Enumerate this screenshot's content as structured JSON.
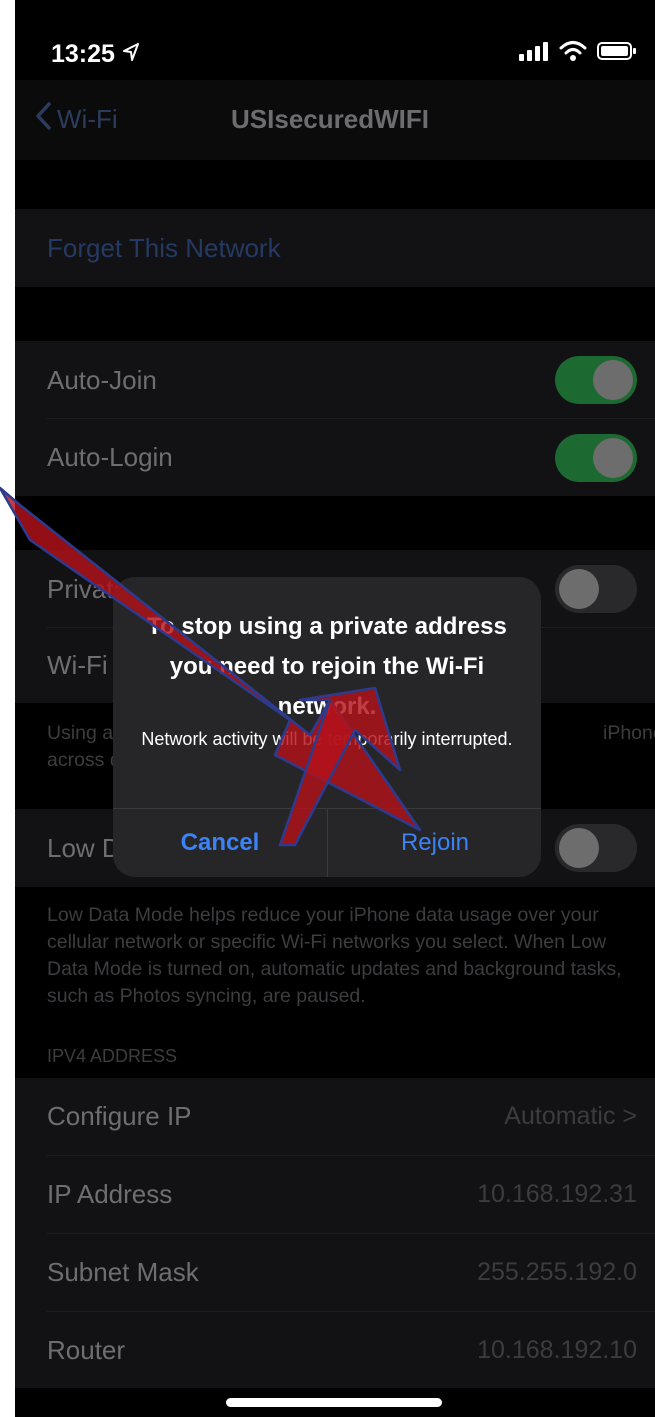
{
  "status": {
    "time": "13:25"
  },
  "nav": {
    "back_label": "Wi-Fi",
    "title": "USIsecuredWIFI"
  },
  "forget": {
    "label": "Forget This Network"
  },
  "auto": {
    "join_label": "Auto-Join",
    "join_on": true,
    "login_label": "Auto-Login",
    "login_on": true
  },
  "private": {
    "label": "Private",
    "address_label": "Wi-Fi A",
    "note": "Using a p",
    "note_right": "iPhone",
    "note_line2": "across d"
  },
  "low_data": {
    "label": "Low Da",
    "note": "Low Data Mode helps reduce your iPhone data usage over your cellular network or specific Wi-Fi networks you select. When Low Data Mode is turned on, automatic updates and background tasks, such as Photos syncing, are paused."
  },
  "ipv4": {
    "header": "IPV4 ADDRESS",
    "rows": [
      {
        "label": "Configure IP",
        "value": "Automatic >"
      },
      {
        "label": "IP Address",
        "value": "10.168.192.31"
      },
      {
        "label": "Subnet Mask",
        "value": "255.255.192.0"
      },
      {
        "label": "Router",
        "value": "10.168.192.10"
      }
    ]
  },
  "dialog": {
    "title": "To stop using a private address you need to rejoin the Wi-Fi network.",
    "message": "Network activity will be temporarily interrupted.",
    "cancel": "Cancel",
    "rejoin": "Rejoin"
  },
  "colors": {
    "accent": "#3b82f6",
    "toggle_on": "#1c6a31",
    "arrow": "#b3121a"
  }
}
